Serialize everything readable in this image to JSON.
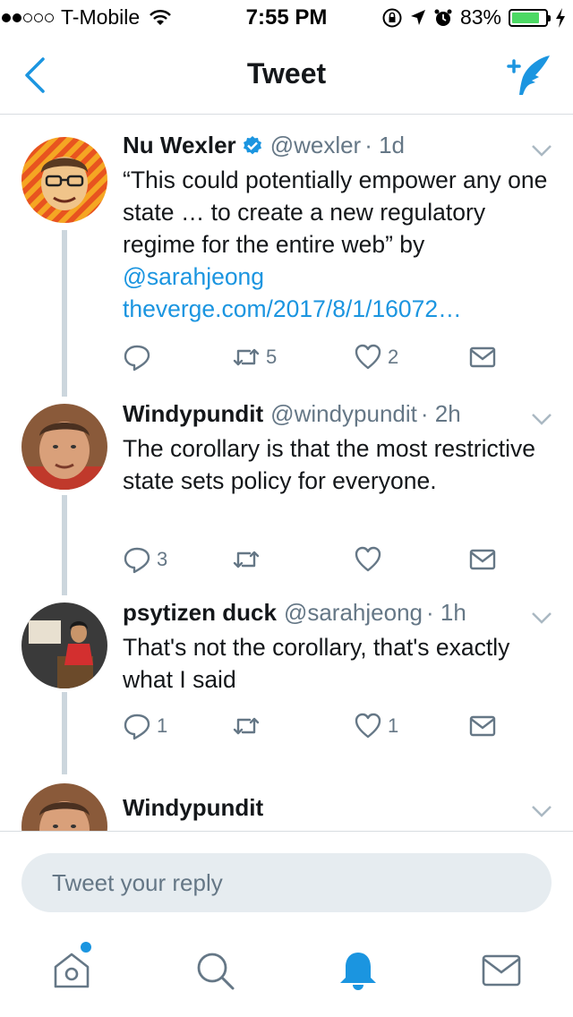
{
  "status_bar": {
    "carrier": "T-Mobile",
    "time": "7:55 PM",
    "battery": "83%",
    "battery_level": 0.83
  },
  "nav": {
    "title": "Tweet"
  },
  "colors": {
    "accent": "#1b95e0",
    "thread_line": "#ccd6dd",
    "muted": "#657786"
  },
  "tweets": [
    {
      "name": "Nu Wexler",
      "verified": true,
      "handle": "@wexler",
      "time": "· 1d",
      "text_1": "“This could potentially empower any one state … to create a new regulatory regime for the entire web” by ",
      "mention": "@sarahjeong",
      "link": "theverge.com/2017/8/1/16072…",
      "replies": "",
      "retweets": "5",
      "likes": "2"
    },
    {
      "name": "Windypundit",
      "handle": "@windypundit",
      "time": "· 2h",
      "text": "The corollary is that the most restrictive state sets policy for everyone.",
      "replies": "3",
      "retweets": "",
      "likes": ""
    },
    {
      "name": "psytizen duck",
      "handle": "@sarahjeong",
      "time": "· 1h",
      "text": "That's not the corollary, that's exactly what I said",
      "replies": "1",
      "retweets": "",
      "likes": "1"
    },
    {
      "name": "Windypundit"
    }
  ],
  "reply": {
    "placeholder": "Tweet your reply"
  },
  "tabs": [
    "home-icon",
    "search-icon",
    "notifications-icon",
    "messages-icon"
  ]
}
